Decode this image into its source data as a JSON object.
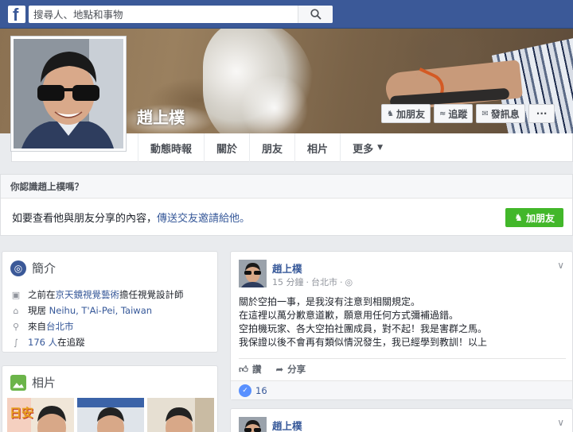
{
  "topbar": {
    "logo": "f",
    "search_placeholder": "搜尋人、地點和事物"
  },
  "profile": {
    "name": "趙上樸",
    "cover_buttons": [
      {
        "icon": "add-friend-icon",
        "label": "加朋友"
      },
      {
        "icon": "follow-icon",
        "label": "追蹤"
      },
      {
        "icon": "message-icon",
        "label": "發訊息"
      },
      {
        "icon": "more-icon",
        "label": "···"
      }
    ],
    "tabs": [
      "動態時報",
      "關於",
      "朋友",
      "相片",
      "更多"
    ]
  },
  "know_card": {
    "title": "你認識趙上樸嗎？",
    "body_prefix": "如要查看他與朋友分享的內容，",
    "body_link": "傳送交友邀請給他。",
    "button": "加朋友"
  },
  "intro": {
    "title": "簡介",
    "rows": [
      {
        "icon": "work-icon",
        "prefix": "之前在",
        "link": "京天鏡視覺藝術",
        "suffix": "擔任視覺設計師"
      },
      {
        "icon": "home-icon",
        "prefix": "現居 ",
        "link": "Neihu, T'Ai-Pei, Taiwan",
        "suffix": ""
      },
      {
        "icon": "location-icon",
        "prefix": "來自",
        "link": "台北市",
        "suffix": ""
      },
      {
        "icon": "rss-icon",
        "prefix": "",
        "link": "176 人",
        "suffix": "在追蹤"
      }
    ]
  },
  "photos": {
    "title": "相片",
    "thumb_text": "日安"
  },
  "post": {
    "author": "趙上樸",
    "time": "15 分鐘",
    "location": "台北市",
    "text": "關於空拍一事，是我沒有注意到相關規定。\n在這裡以萬分歉意道歉，願意用任何方式彌補過錯。\n空拍機玩家、各大空拍社團成員，對不起！我是害群之馬。\n我保證以後不會再有類似情況發生，我已經學到教訓！以上",
    "like_label": "讚",
    "share_label": "分享",
    "like_count": "16"
  },
  "post2": {
    "author": "趙上樸"
  },
  "colors": {
    "brand": "#3b5998",
    "link": "#365899",
    "green": "#42b72a"
  }
}
